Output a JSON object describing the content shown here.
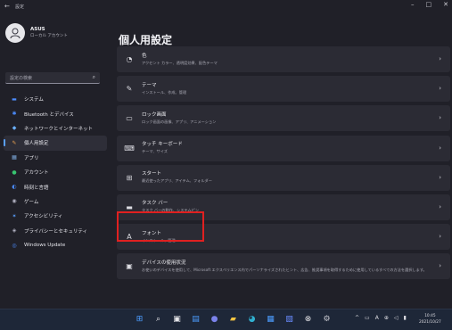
{
  "window": {
    "title": "設定",
    "back_glyph": "←",
    "min_glyph": "–",
    "max_glyph": "□",
    "close_glyph": "✕"
  },
  "user": {
    "name": "ASUS",
    "subtitle": "ローカル アカウント"
  },
  "search": {
    "placeholder": "設定の検索",
    "icon": "search-icon"
  },
  "nav": {
    "items": [
      {
        "label": "システム",
        "icon": "system-icon",
        "color": "#4c8dff"
      },
      {
        "label": "Bluetooth とデバイス",
        "icon": "bluetooth-icon",
        "color": "#4c8dff"
      },
      {
        "label": "ネットワークとインターネット",
        "icon": "network-icon",
        "color": "#6ab0ff"
      },
      {
        "label": "個人用設定",
        "icon": "brush-icon",
        "color": "#e8a050",
        "active": true
      },
      {
        "label": "アプリ",
        "icon": "apps-icon",
        "color": "#7aa6d8"
      },
      {
        "label": "アカウント",
        "icon": "account-icon",
        "color": "#38c470"
      },
      {
        "label": "時刻と言語",
        "icon": "clock-globe-icon",
        "color": "#4c8dff"
      },
      {
        "label": "ゲーム",
        "icon": "game-icon",
        "color": "#b0b0c0"
      },
      {
        "label": "アクセシビリティ",
        "icon": "accessibility-icon",
        "color": "#5aa0ff"
      },
      {
        "label": "プライバシーとセキュリティ",
        "icon": "shield-icon",
        "color": "#b0b0c0"
      },
      {
        "label": "Windows Update",
        "icon": "update-icon",
        "color": "#4c8dff"
      }
    ]
  },
  "page": {
    "title": "個人用設定"
  },
  "cards": [
    {
      "title": "色",
      "desc": "アクセント カラー、透明度効果、配色テーマ",
      "icon": "palette-icon",
      "glyph": "◔"
    },
    {
      "title": "テーマ",
      "desc": "インストール、作成、管理",
      "icon": "theme-brush-icon",
      "glyph": "✎"
    },
    {
      "title": "ロック画面",
      "desc": "ロック画面の画像、アプリ、アニメーション",
      "icon": "lock-screen-icon",
      "glyph": "▭"
    },
    {
      "title": "タッチ キーボード",
      "desc": "テーマ、サイズ",
      "icon": "keyboard-icon",
      "glyph": "⌨"
    },
    {
      "title": "スタート",
      "desc": "最近使ったアプリ、アイテム、フォルダー",
      "icon": "start-icon",
      "glyph": "⊞"
    },
    {
      "title": "タスク バー",
      "desc": "タスク バーの動作、システムピン",
      "icon": "taskbar-icon",
      "glyph": "▬"
    },
    {
      "title": "フォント",
      "desc": "インストール、管理",
      "icon": "font-icon",
      "glyph": "A"
    },
    {
      "title": "デバイスの使用状況",
      "desc": "お使いのデバイスを使用して、Microsoft エクスペリエンス内でパーソナライズされたヒント、広告、推奨事項を取得するために使用しているすべての方法を選択します。",
      "icon": "device-usage-icon",
      "glyph": "▣"
    }
  ],
  "chevron": "›",
  "taskbar": {
    "apps": [
      {
        "name": "start-icon",
        "glyph": "⊞",
        "color": "#4c9dff"
      },
      {
        "name": "search-icon",
        "glyph": "⌕",
        "color": "#e6e6ea"
      },
      {
        "name": "task-view-icon",
        "glyph": "▣",
        "color": "#e6e6ea"
      },
      {
        "name": "widgets-icon",
        "glyph": "▤",
        "color": "#4c9dff"
      },
      {
        "name": "chat-icon",
        "glyph": "●",
        "color": "#7b83eb"
      },
      {
        "name": "explorer-icon",
        "glyph": "▰",
        "color": "#f5c542"
      },
      {
        "name": "edge-icon",
        "glyph": "◕",
        "color": "#30b0d0"
      },
      {
        "name": "store-icon",
        "glyph": "▦",
        "color": "#4c9dff"
      },
      {
        "name": "photos-icon",
        "glyph": "▧",
        "color": "#6a8cff"
      },
      {
        "name": "xbox-icon",
        "glyph": "⊗",
        "color": "#e6e6ea"
      },
      {
        "name": "settings-icon",
        "glyph": "⚙",
        "color": "#c8c8d0"
      }
    ],
    "tray": [
      {
        "name": "chevron-up-icon",
        "glyph": "^"
      },
      {
        "name": "display-icon",
        "glyph": "▭"
      },
      {
        "name": "ime-icon",
        "glyph": "A"
      },
      {
        "name": "network-icon",
        "glyph": "⊕"
      },
      {
        "name": "volume-icon",
        "glyph": "◁"
      },
      {
        "name": "battery-icon",
        "glyph": "▮"
      }
    ],
    "time": "10:45",
    "date": "2021/10/27"
  },
  "accent": "#5aa0ff",
  "highlight_color": "#e02020"
}
